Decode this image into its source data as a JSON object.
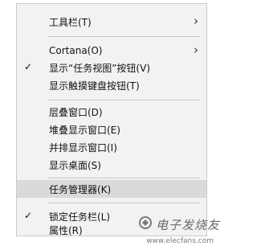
{
  "menu": {
    "items": [
      {
        "label": "工具栏(T)",
        "submenu": true,
        "checked": false
      },
      {
        "label": "Cortana(O)",
        "submenu": true,
        "checked": false
      },
      {
        "label": "显示“任务视图”按钮(V)",
        "submenu": false,
        "checked": true
      },
      {
        "label": "显示触摸键盘按钮(T)",
        "submenu": false,
        "checked": false
      },
      {
        "label": "层叠窗口(D)",
        "submenu": false,
        "checked": false
      },
      {
        "label": "堆叠显示窗口(E)",
        "submenu": false,
        "checked": false
      },
      {
        "label": "并排显示窗口(I)",
        "submenu": false,
        "checked": false
      },
      {
        "label": "显示桌面(S)",
        "submenu": false,
        "checked": false
      },
      {
        "label": "任务管理器(K)",
        "submenu": false,
        "checked": false,
        "highlighted": true
      },
      {
        "label": "锁定任务栏(L)",
        "submenu": false,
        "checked": true
      },
      {
        "label": "属性(R)",
        "submenu": false,
        "checked": false
      }
    ],
    "check_glyph": "✓",
    "arrow_glyph": "›"
  },
  "watermark": {
    "text": "电子发烧友",
    "url": "www.elecfans.com",
    "icon": "logo-icon"
  },
  "colors": {
    "menu_bg": "#f2f2f2",
    "highlight": "#dadada",
    "border": "#c9c9c9"
  }
}
